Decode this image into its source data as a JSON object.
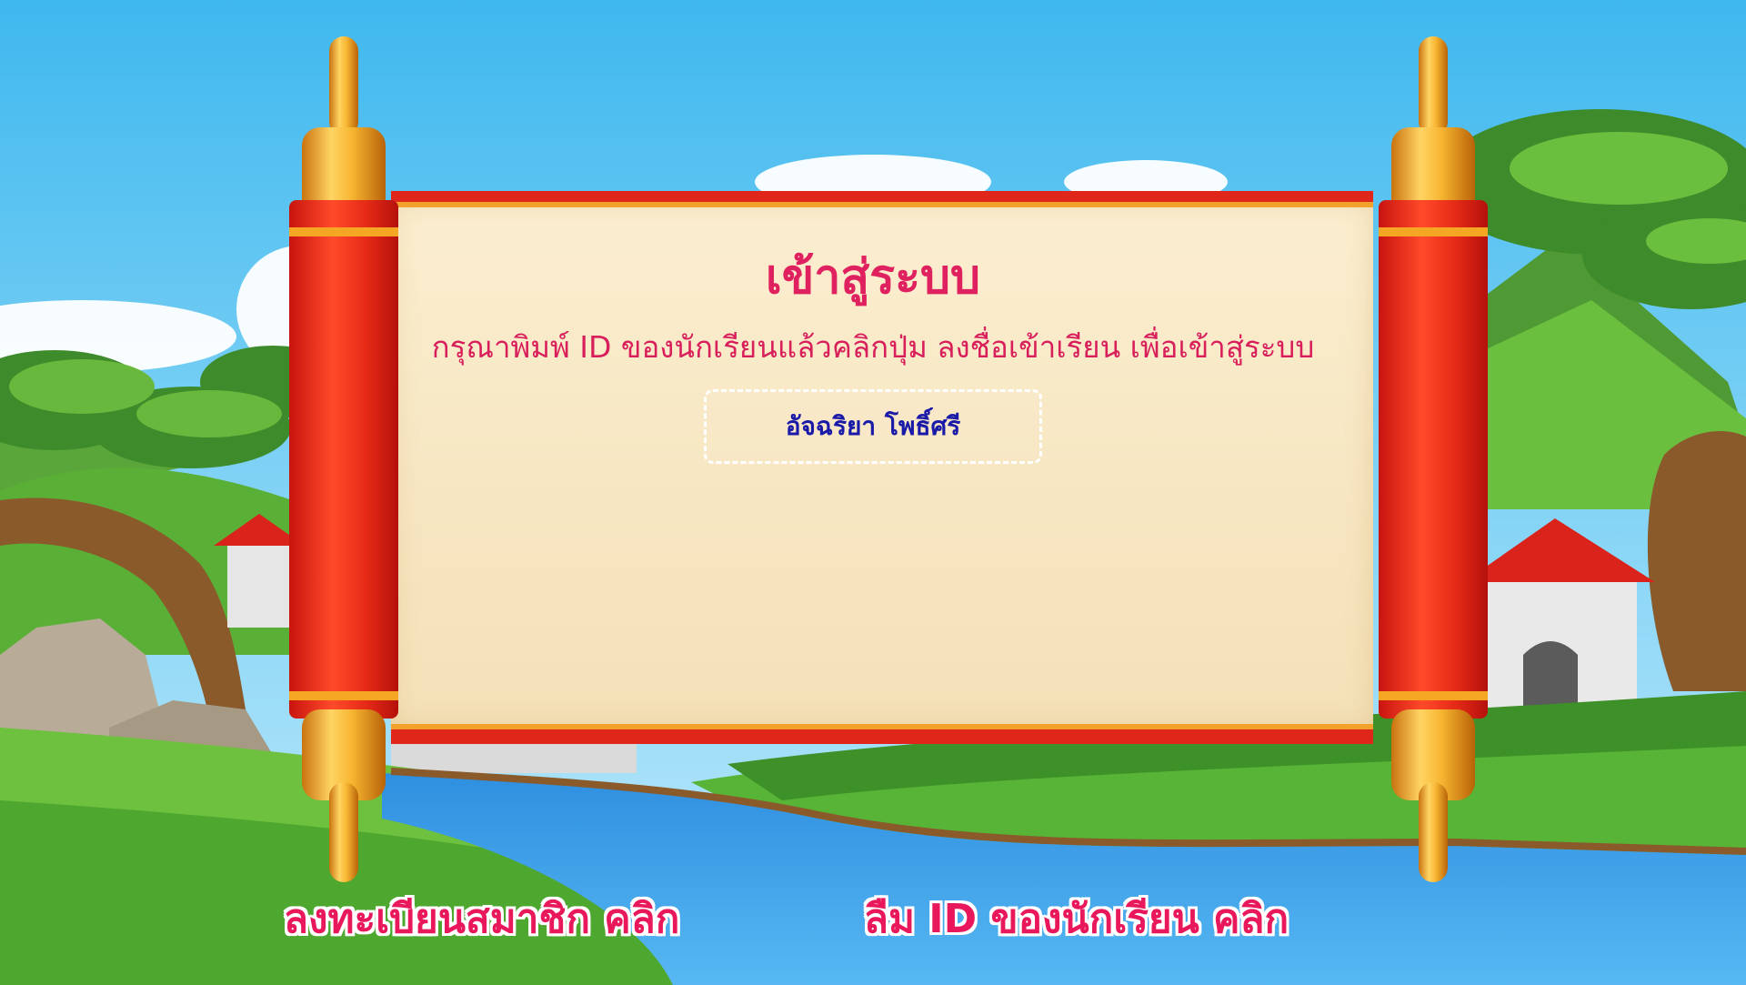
{
  "login": {
    "title": "เข้าสู่ระบบ",
    "instruction": "กรุณาพิมพ์ ID ของนักเรียนแล้วคลิกปุ่ม ลงชื่อเข้าเรียน เพื่อเข้าสู่ระบบ",
    "id_value": "อัจฉริยา โพธิ์ศรี"
  },
  "links": {
    "register": "ลงทะเบียนสมาชิก คลิก",
    "forgot_id": "ลืม ID ของนักเรียน คลิก"
  },
  "colors": {
    "title": "#e0215f",
    "id_text": "#1a1aa8",
    "scroll_red": "#e0251b",
    "scroll_gold": "#f2a22a",
    "paper": "#f8ebcc"
  },
  "icons": [
    "scroll-left-roller-icon",
    "scroll-right-roller-icon",
    "tree-icon",
    "pagoda-icon",
    "river-icon"
  ]
}
